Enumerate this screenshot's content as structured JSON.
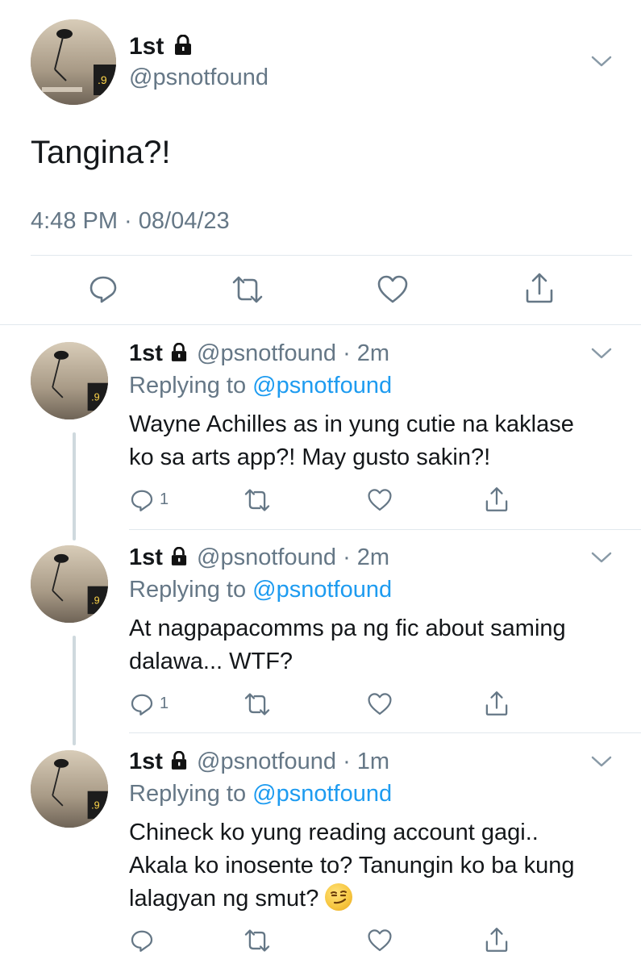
{
  "main_tweet": {
    "name": "1st",
    "handle": "@psnotfound",
    "text": "Tangina?!",
    "timestamp": "4:48 PM · 08/04/23",
    "actions": [
      "reply-icon",
      "retweet-icon",
      "like-icon",
      "share-icon"
    ]
  },
  "replies": [
    {
      "name": "1st",
      "handle": "@psnotfound",
      "time": "· 2m",
      "replying_label": "Replying to",
      "replying_handle": "@psnotfound",
      "lines": [
        "Wayne Achilles as in yung cutie na kaklase",
        "ko sa arts app?! May gusto sakin?!"
      ],
      "reply_count": "1"
    },
    {
      "name": "1st",
      "handle": "@psnotfound",
      "time": "· 2m",
      "replying_label": "Replying to",
      "replying_handle": "@psnotfound",
      "lines": [
        "At nagpapacomms pa ng fic about saming",
        "dalawa... WTF?"
      ],
      "reply_count": "1"
    },
    {
      "name": "1st",
      "handle": "@psnotfound",
      "time": "· 1m",
      "replying_label": "Replying to",
      "replying_handle": "@psnotfound",
      "lines": [
        "Chineck ko yung reading account gagi..",
        "Akala ko inosente to? Tanungin ko ba kung",
        "lalagyan ng smut?"
      ],
      "emoji": "smirking-face-emoji",
      "reply_count": ""
    }
  ],
  "colors": {
    "link": "#1d9bf0",
    "muted": "#657786",
    "text": "#14171a",
    "divider": "#e1e8ed"
  }
}
